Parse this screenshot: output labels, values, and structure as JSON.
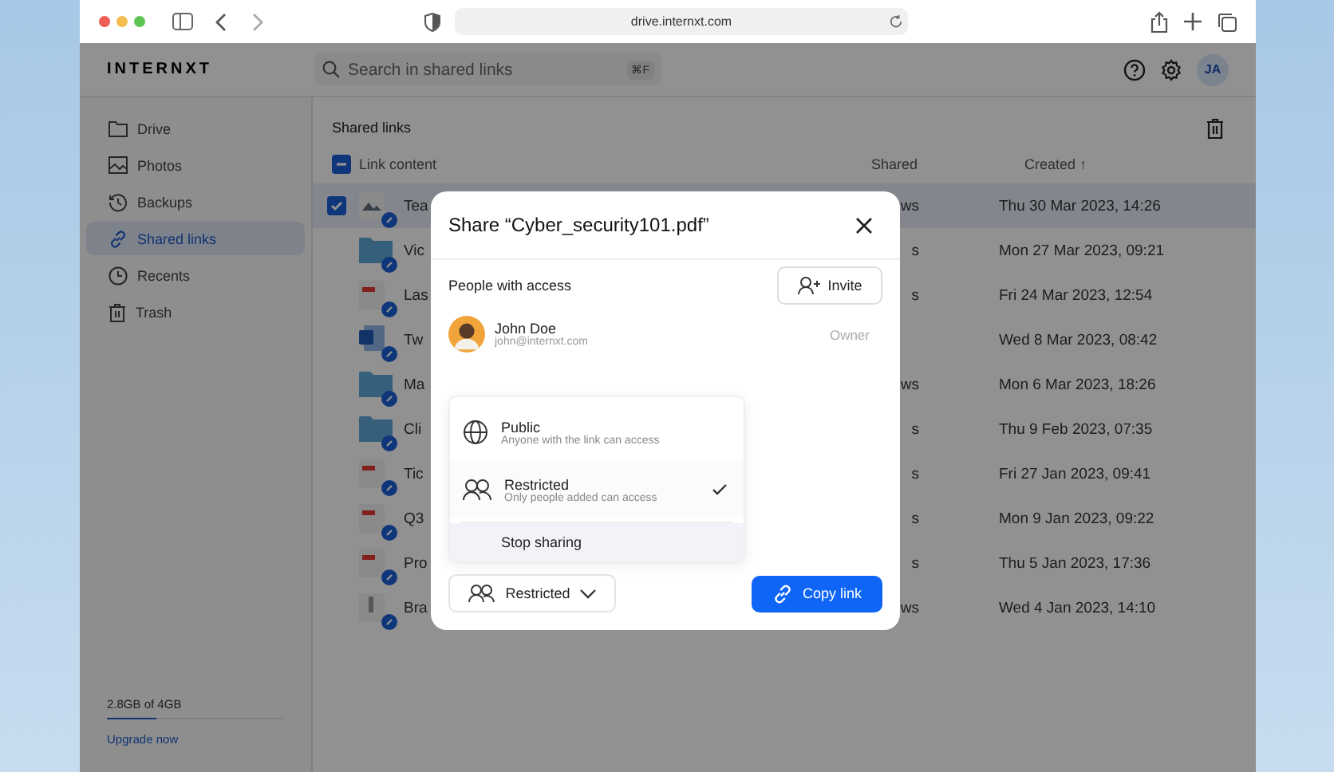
{
  "browser": {
    "url": "drive.internxt.com"
  },
  "header": {
    "logo": "INTERNXT",
    "search": {
      "placeholder": "Search in shared links",
      "shortcut": "⌘F"
    },
    "avatar": "JA"
  },
  "sidebar": {
    "items": [
      {
        "label": "Drive",
        "selected": false
      },
      {
        "label": "Photos",
        "selected": false
      },
      {
        "label": "Backups",
        "selected": false
      },
      {
        "label": "Shared links",
        "selected": true
      },
      {
        "label": "Recents",
        "selected": false
      },
      {
        "label": "Trash",
        "selected": false
      }
    ],
    "storage": {
      "text": "2.8GB of 4GB",
      "level": 0.28
    },
    "upgrade": "Upgrade now"
  },
  "content": {
    "title": "Shared links",
    "table": {
      "select_all_indeterminate": true,
      "columns": [
        "Link content",
        "Shared",
        "Created"
      ],
      "sort_mark": "↑",
      "rows": [
        {
          "kind": "image",
          "name": "Tea",
          "shared": "ws",
          "created": "Thu 30 Mar 2023, 14:26",
          "selected": true
        },
        {
          "kind": "folder",
          "name": "Vic",
          "shared": "s",
          "created": "Mon 27 Mar 2023, 09:21",
          "selected": false
        },
        {
          "kind": "pdf",
          "name": "Las",
          "shared": "s",
          "created": "Fri 24 Mar 2023, 12:54",
          "selected": false
        },
        {
          "kind": "word",
          "name": "Tw",
          "created": "Wed 8 Mar 2023, 08:42",
          "selected": false
        },
        {
          "kind": "folder",
          "name": "Ma",
          "shared": "ws",
          "created": "Mon 6 Mar 2023, 18:26",
          "selected": false
        },
        {
          "kind": "folder",
          "name": "Cli",
          "shared": "s",
          "created": "Thu 9 Feb 2023, 07:35",
          "selected": false
        },
        {
          "kind": "pdf",
          "name": "Tic",
          "shared": "s",
          "created": "Fri 27 Jan 2023, 09:41",
          "selected": false
        },
        {
          "kind": "pdf",
          "name": "Q3",
          "shared": "s",
          "created": "Mon 9 Jan 2023, 09:22",
          "selected": false
        },
        {
          "kind": "pdf",
          "name": "Pro",
          "shared": "s",
          "created": "Thu 5 Jan 2023, 17:36",
          "selected": false
        },
        {
          "kind": "archive",
          "name": "Bra",
          "shared": "ws",
          "created": "Wed 4 Jan 2023, 14:10",
          "selected": false
        }
      ]
    }
  },
  "dialog": {
    "title": "Share “Cyber_security101.pdf”",
    "section": "People with access",
    "invite": "Invite",
    "person": {
      "name": "John Doe",
      "email": "john@internxt.com",
      "role": "Owner"
    },
    "menu": {
      "options": [
        {
          "label": "Public",
          "description": "Anyone with the link can access",
          "selected": false
        },
        {
          "label": "Restricted",
          "description": "Only people added can access",
          "selected": true
        }
      ],
      "stop": "Stop sharing"
    },
    "access_button": "Restricted",
    "copy_button": "Copy link"
  }
}
